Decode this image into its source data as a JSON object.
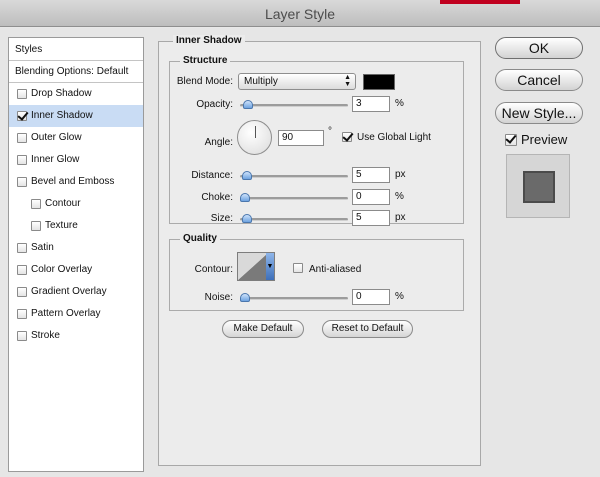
{
  "window": {
    "title": "Layer Style"
  },
  "sidebar": {
    "header": "Styles",
    "blending": "Blending Options: Default",
    "items": [
      {
        "label": "Drop Shadow",
        "checked": false,
        "indent": false
      },
      {
        "label": "Inner Shadow",
        "checked": true,
        "indent": false,
        "selected": true
      },
      {
        "label": "Outer Glow",
        "checked": false,
        "indent": false
      },
      {
        "label": "Inner Glow",
        "checked": false,
        "indent": false
      },
      {
        "label": "Bevel and Emboss",
        "checked": false,
        "indent": false
      },
      {
        "label": "Contour",
        "checked": false,
        "indent": true
      },
      {
        "label": "Texture",
        "checked": false,
        "indent": true
      },
      {
        "label": "Satin",
        "checked": false,
        "indent": false
      },
      {
        "label": "Color Overlay",
        "checked": false,
        "indent": false
      },
      {
        "label": "Gradient Overlay",
        "checked": false,
        "indent": false
      },
      {
        "label": "Pattern Overlay",
        "checked": false,
        "indent": false
      },
      {
        "label": "Stroke",
        "checked": false,
        "indent": false
      }
    ]
  },
  "panel": {
    "title": "Inner Shadow",
    "structure": {
      "title": "Structure",
      "blend_mode_label": "Blend Mode:",
      "blend_mode_value": "Multiply",
      "blend_color": "#000000",
      "opacity_label": "Opacity:",
      "opacity_value": "3",
      "opacity_unit": "%",
      "opacity_level": 0.03,
      "angle_label": "Angle:",
      "angle_value": "90",
      "angle_unit": "°",
      "global_light_label": "Use Global Light",
      "global_light_checked": true,
      "distance_label": "Distance:",
      "distance_value": "5",
      "distance_unit": "px",
      "distance_level": 0.02,
      "choke_label": "Choke:",
      "choke_value": "0",
      "choke_unit": "%",
      "choke_level": 0,
      "size_label": "Size:",
      "size_value": "5",
      "size_unit": "px",
      "size_level": 0.02
    },
    "quality": {
      "title": "Quality",
      "contour_label": "Contour:",
      "anti_aliased_label": "Anti-aliased",
      "anti_aliased_checked": false,
      "noise_label": "Noise:",
      "noise_value": "0",
      "noise_unit": "%",
      "noise_level": 0
    },
    "make_default": "Make Default",
    "reset_default": "Reset to Default"
  },
  "buttons": {
    "ok": "OK",
    "cancel": "Cancel",
    "new_style": "New Style...",
    "preview_label": "Preview",
    "preview_checked": true
  }
}
